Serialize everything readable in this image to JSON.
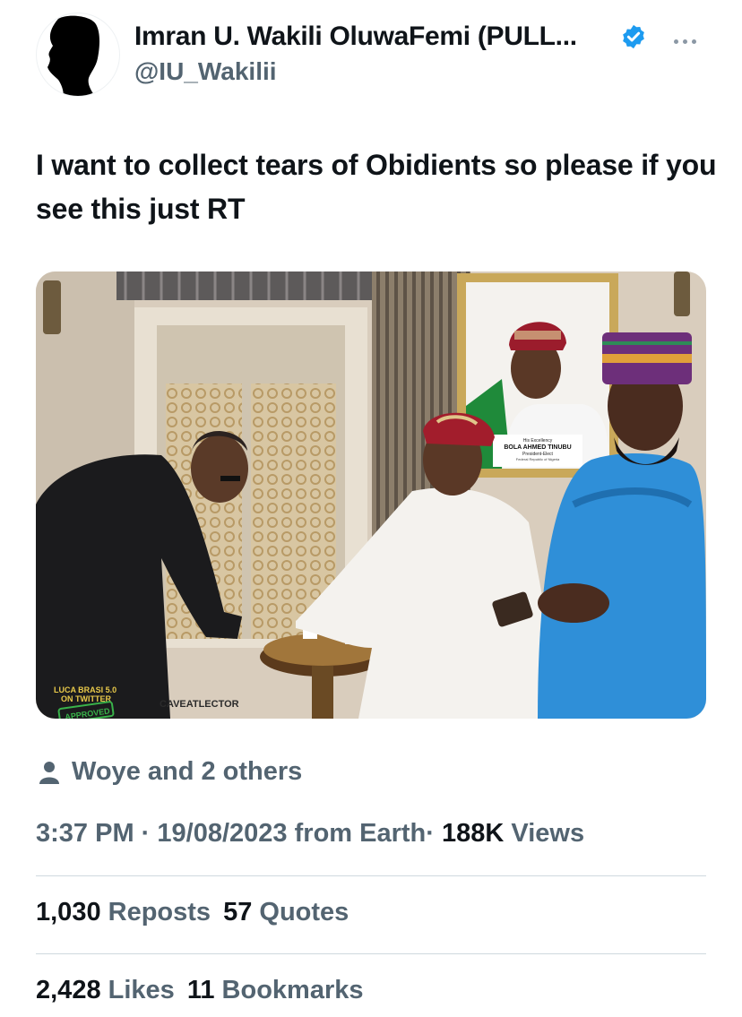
{
  "author": {
    "display_name": "Imran U. Wakili OluwaFemi (PULL...",
    "handle": "@IU_Wakilii",
    "verified": true,
    "avatar_icon": "silhouette-head-avatar"
  },
  "tweet": {
    "text": "I want to collect tears of Obidients so please if you see this just RT"
  },
  "media": {
    "portrait_caption_small": "His Excellency",
    "portrait_caption_name": "BOLA AHMED TINUBU",
    "portrait_caption_title": "President-Elect",
    "portrait_caption_country": "Federal Republic of Nigeria",
    "watermark_left_1": "LUCA BRASI 5.0",
    "watermark_left_2": "ON TWITTER",
    "watermark_stamp": "APPROVED",
    "watermark_credit": "CAVEATLECTOR"
  },
  "social_context": {
    "icon": "person-icon",
    "text": "Woye and 2 others"
  },
  "meta": {
    "time": "3:37 PM",
    "sep1": "·",
    "date": "19/08/2023",
    "source": "from Earth",
    "sep2": "·",
    "views_count": "188K",
    "views_label": "Views"
  },
  "stats": {
    "reposts_count": "1,030",
    "reposts_label": "Reposts",
    "quotes_count": "57",
    "quotes_label": "Quotes",
    "likes_count": "2,428",
    "likes_label": "Likes",
    "bookmarks_count": "11",
    "bookmarks_label": "Bookmarks"
  },
  "colors": {
    "text_primary": "#0f1419",
    "text_secondary": "#536471",
    "verified_blue": "#1d9bf0",
    "divider": "#cfd9de"
  }
}
